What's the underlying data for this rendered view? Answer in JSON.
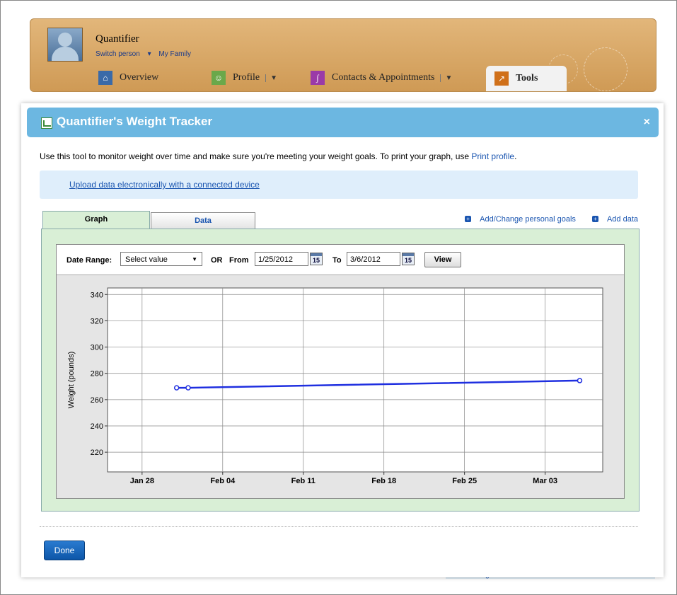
{
  "header": {
    "person_name": "Quantifier",
    "switch_person": "Switch person",
    "my_family": "My Family",
    "tabs": {
      "overview": "Overview",
      "profile": "Profile",
      "contacts": "Contacts & Appointments",
      "tools": "Tools"
    }
  },
  "modal": {
    "title": "Quantifier's Weight Tracker",
    "close": "×",
    "intro_text": "Use this tool to monitor weight over time and make sure you're meeting your weight goals. To print your graph, use ",
    "print_link": "Print profile",
    "intro_end": ".",
    "upload_link": "Upload data electronically with a connected device",
    "tabs": {
      "graph": "Graph",
      "data": "Data"
    },
    "links": {
      "goals": "Add/Change personal goals",
      "add_data": "Add data"
    },
    "controls": {
      "date_range_label": "Date Range:",
      "select_value": "Select value",
      "or_label": "OR",
      "from_label": "From",
      "from_value": "1/25/2012",
      "to_label": "To",
      "to_value": "3/6/2012",
      "cal_icon": "15",
      "view_button": "View"
    },
    "done_button": "Done"
  },
  "background": {
    "partial_text": "Allergies"
  },
  "chart_data": {
    "type": "line",
    "ylabel": "Weight (pounds)",
    "ylim": [
      205,
      345
    ],
    "yticks": [
      220,
      240,
      260,
      280,
      300,
      320,
      340
    ],
    "xlim": [
      "2012-01-25",
      "2012-03-08"
    ],
    "xticks": [
      {
        "label": "Jan 28",
        "date": "2012-01-28"
      },
      {
        "label": "Feb 04",
        "date": "2012-02-04"
      },
      {
        "label": "Feb 11",
        "date": "2012-02-11"
      },
      {
        "label": "Feb 18",
        "date": "2012-02-18"
      },
      {
        "label": "Feb 25",
        "date": "2012-02-25"
      },
      {
        "label": "Mar 03",
        "date": "2012-03-03"
      }
    ],
    "series": [
      {
        "points": [
          {
            "x": "2012-01-31",
            "y": 269
          },
          {
            "x": "2012-02-01",
            "y": 269
          },
          {
            "x": "2012-03-06",
            "y": 274.5
          }
        ]
      }
    ],
    "grid": true,
    "colors": {
      "line": "#1f2fe0"
    }
  }
}
